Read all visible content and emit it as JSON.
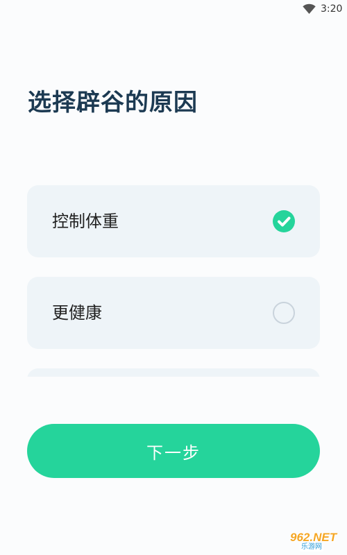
{
  "status_bar": {
    "time": "3:20",
    "wifi_icon": "wifi-icon"
  },
  "page": {
    "title": "选择辟谷的原因"
  },
  "options": [
    {
      "label": "控制体重",
      "selected": true,
      "icon": "check-circle-icon"
    },
    {
      "label": "更健康",
      "selected": false,
      "icon": "radio-empty-icon"
    },
    {
      "label": "",
      "selected": false,
      "icon": ""
    }
  ],
  "next_button": {
    "label": "下一步"
  },
  "watermark": {
    "brand": "962.NET",
    "sub": "乐游网"
  },
  "colors": {
    "accent": "#25d49b",
    "title": "#1c3a52",
    "card_bg": "#eef4f8",
    "page_bg": "#fbfcfd"
  }
}
